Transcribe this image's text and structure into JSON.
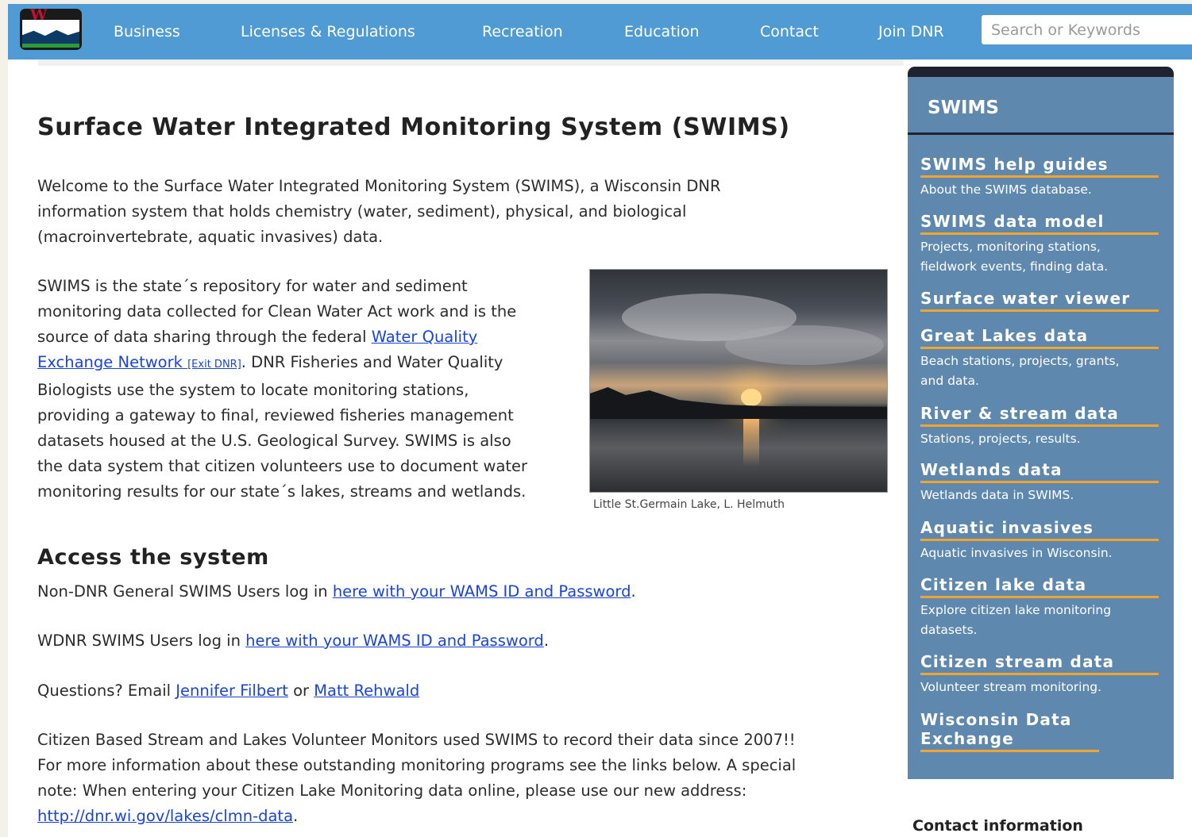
{
  "nav": {
    "items": [
      {
        "label": "Business"
      },
      {
        "label": "Licenses & Regulations"
      },
      {
        "label": "Recreation"
      },
      {
        "label": "Education"
      },
      {
        "label": "Contact"
      },
      {
        "label": "Join DNR"
      }
    ],
    "search_placeholder": "Search or Keywords"
  },
  "page": {
    "title": "Surface Water Integrated Monitoring System (SWIMS)",
    "intro": {
      "lines": [
        "Welcome to the Surface Water Integrated Monitoring System (SWIMS), a Wisconsin DNR",
        "information system that holds chemistry (water, sediment), physical, and biological",
        "(macroinvertebrate, aquatic invasives) data."
      ]
    },
    "repo": {
      "line1": "SWIMS is the state´s repository for water and sediment",
      "line2": "monitoring data collected for Clean Water Act work and is the",
      "line3_pre": "source of data sharing through the federal ",
      "wqx_link_line1": "Water Quality",
      "wqx_link_line2": "Exchange Network",
      "exit_tag": "[Exit DNR]",
      "line4_post": ". DNR Fisheries and Water Quality",
      "rest": [
        "Biologists use the system to locate monitoring stations,",
        "providing a gateway to final, reviewed fisheries management",
        "datasets housed at the U.S. Geological Survey. SWIMS is also",
        "the data system that citizen volunteers use to document water",
        "monitoring results for our state´s lakes, streams and wetlands."
      ]
    },
    "photo_caption": "Little St.Germain Lake, L. Helmuth",
    "access": {
      "heading": "Access the system",
      "non_dnr_pre": "Non-DNR General SWIMS Users log in ",
      "non_dnr_link": "here with your WAMS ID and Password",
      "wdnr_pre": "WDNR SWIMS Users log in ",
      "wdnr_link": "here with your WAMS ID and Password",
      "period": ".",
      "questions_pre": "Questions? Email ",
      "contact1": "Jennifer Filbert",
      "or": " or ",
      "contact2": "Matt Rehwald",
      "citizen_lines": [
        "Citizen Based Stream and Lakes Volunteer Monitors used SWIMS to record their data since 2007!!",
        "For more information about these outstanding monitoring programs see the links below. A special",
        "note: When entering your Citizen Lake Monitoring data online, please use our new address:"
      ],
      "clmn_link": "http://dnr.wi.gov/lakes/clmn-data"
    }
  },
  "sidebar": {
    "title": "SWIMS",
    "items": [
      {
        "label": "SWIMS help guides",
        "desc": [
          "About the SWIMS database."
        ]
      },
      {
        "label": "SWIMS data model",
        "desc": [
          "Projects, monitoring stations,",
          "fieldwork events, finding data."
        ]
      },
      {
        "label": "Surface water viewer",
        "desc": []
      },
      {
        "label": "Great Lakes data",
        "desc": [
          "Beach stations, projects, grants,",
          "and data."
        ]
      },
      {
        "label": "River & stream data",
        "desc": [
          "Stations, projects, results."
        ]
      },
      {
        "label": "Wetlands data",
        "desc": [
          "Wetlands data in SWIMS."
        ]
      },
      {
        "label": "Aquatic invasives",
        "desc": [
          "Aquatic invasives in Wisconsin."
        ]
      },
      {
        "label": "Citizen lake data",
        "desc": [
          "Explore citizen lake monitoring",
          "datasets."
        ]
      },
      {
        "label": "Citizen stream data",
        "desc": [
          "Volunteer stream monitoring."
        ]
      },
      {
        "label": "Wisconsin Data Exchange",
        "desc": []
      }
    ]
  },
  "contact_heading": "Contact information",
  "colors": {
    "nav_bg": "#519bd5",
    "sidebar_bg": "#5e88ae",
    "accent_orange": "#f2a52a",
    "link_blue": "#1a44d9"
  }
}
